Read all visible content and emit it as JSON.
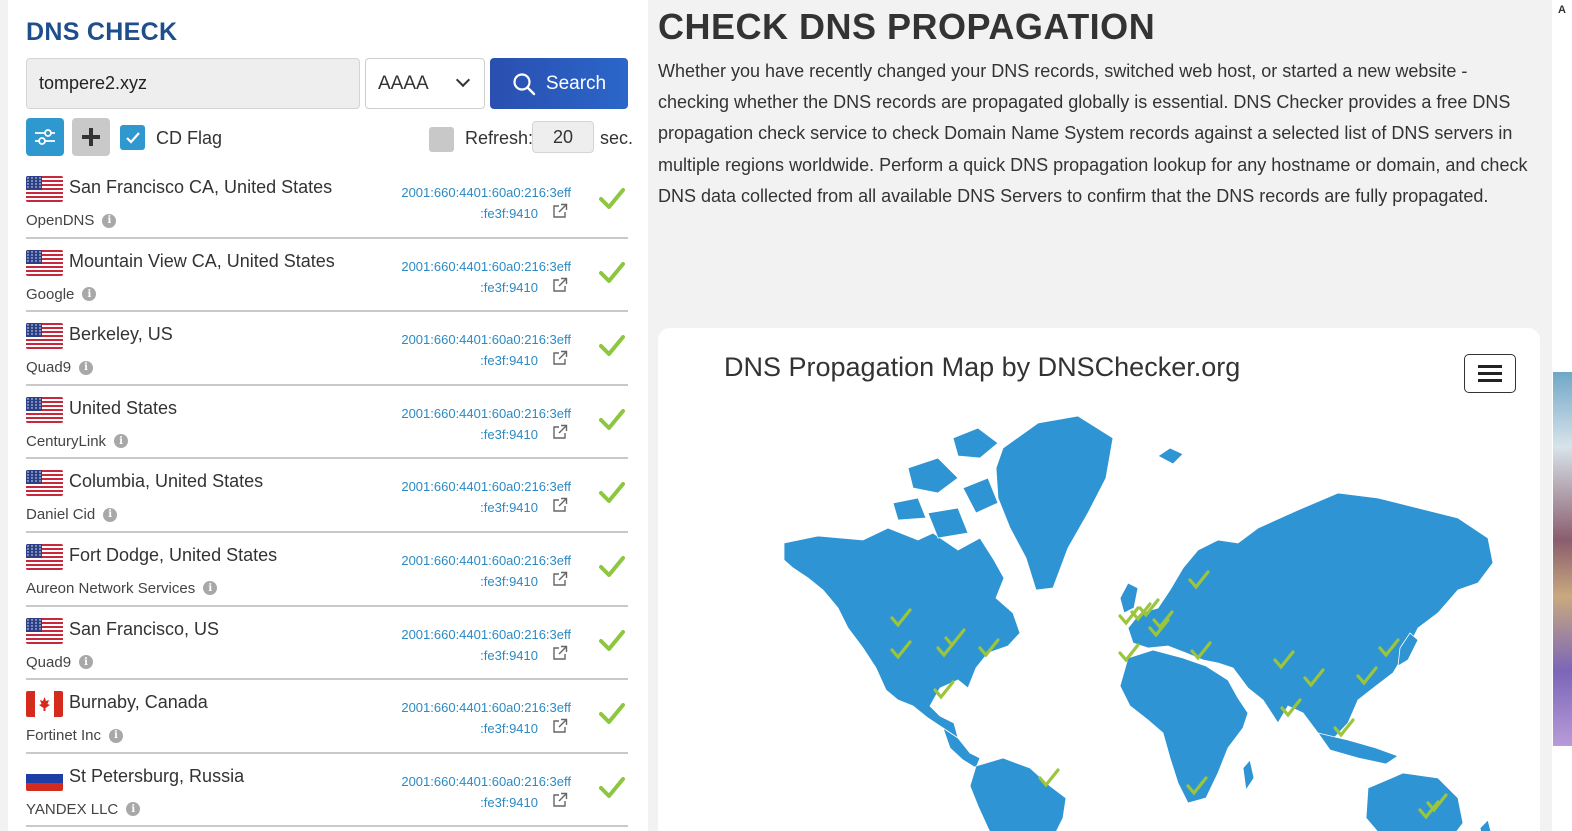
{
  "dns_check": {
    "title": "DNS CHECK",
    "domain_value": "tompere2.xyz",
    "record_type": "AAAA",
    "search_label": "Search",
    "cd_flag_label": "CD Flag",
    "cd_flag_checked": true,
    "refresh_label": "Refresh:",
    "refresh_value": "20",
    "refresh_unit": "sec."
  },
  "results": [
    {
      "flag": "us",
      "location": "San Francisco CA, United States",
      "provider": "OpenDNS",
      "ip_line1": "2001:660:4401:60a0:216:3eff",
      "ip_line2": ":fe3f:9410",
      "status": "ok"
    },
    {
      "flag": "us",
      "location": "Mountain View CA, United States",
      "provider": "Google",
      "ip_line1": "2001:660:4401:60a0:216:3eff",
      "ip_line2": ":fe3f:9410",
      "status": "ok"
    },
    {
      "flag": "us",
      "location": "Berkeley, US",
      "provider": "Quad9",
      "ip_line1": "2001:660:4401:60a0:216:3eff",
      "ip_line2": ":fe3f:9410",
      "status": "ok"
    },
    {
      "flag": "us",
      "location": "United States",
      "provider": "CenturyLink",
      "ip_line1": "2001:660:4401:60a0:216:3eff",
      "ip_line2": ":fe3f:9410",
      "status": "ok"
    },
    {
      "flag": "us",
      "location": "Columbia, United States",
      "provider": "Daniel Cid",
      "ip_line1": "2001:660:4401:60a0:216:3eff",
      "ip_line2": ":fe3f:9410",
      "status": "ok"
    },
    {
      "flag": "us",
      "location": "Fort Dodge, United States",
      "provider": "Aureon Network Services",
      "ip_line1": "2001:660:4401:60a0:216:3eff",
      "ip_line2": ":fe3f:9410",
      "status": "ok"
    },
    {
      "flag": "us",
      "location": "San Francisco, US",
      "provider": "Quad9",
      "ip_line1": "2001:660:4401:60a0:216:3eff",
      "ip_line2": ":fe3f:9410",
      "status": "ok"
    },
    {
      "flag": "ca",
      "location": "Burnaby, Canada",
      "provider": "Fortinet Inc",
      "ip_line1": "2001:660:4401:60a0:216:3eff",
      "ip_line2": ":fe3f:9410",
      "status": "ok"
    },
    {
      "flag": "ru",
      "location": "St Petersburg, Russia",
      "provider": "YANDEX LLC",
      "ip_line1": "2001:660:4401:60a0:216:3eff",
      "ip_line2": ":fe3f:9410",
      "status": "ok"
    }
  ],
  "main": {
    "title": "CHECK DNS PROPAGATION",
    "description": "Whether you have recently changed your DNS records, switched web host, or started a new website - checking whether the DNS records are propagated globally is essential. DNS Checker provides a free DNS propagation check service to check Domain Name System records against a selected list of DNS servers in multiple regions worldwide. Perform a quick DNS propagation lookup for any hostname or domain, and check DNS data collected from all available DNS Servers to confirm that the DNS records are fully propagated."
  },
  "map": {
    "title": "DNS Propagation Map by DNSChecker.org",
    "land_color": "#2e94d3",
    "check_color": "#9bc53d"
  },
  "edge": {
    "letter": "A"
  },
  "colors": {
    "brand": "#1f4e8c",
    "accent": "#2e98cf",
    "ok": "#8dc63f",
    "link": "#2b8ac4"
  }
}
